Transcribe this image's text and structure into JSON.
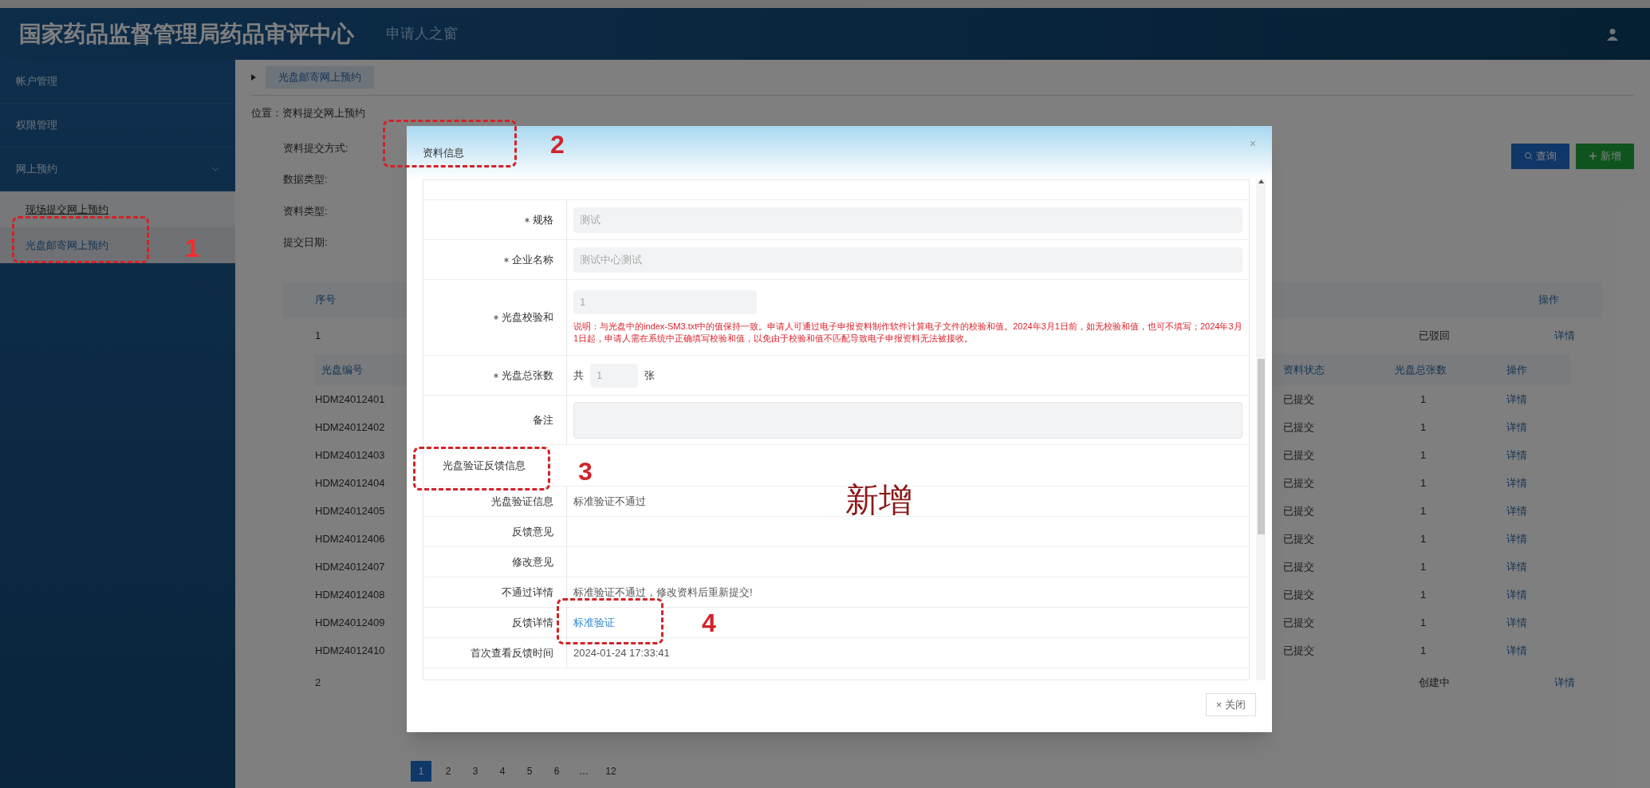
{
  "header": {
    "title": "国家药品监督管理局药品审评中心",
    "subtitle": "申请人之窗"
  },
  "sidebar": {
    "items": [
      {
        "label": "帐户管理",
        "selected": false
      },
      {
        "label": "权限管理",
        "selected": false
      },
      {
        "label": "网上预约",
        "selected": false,
        "expanded": true,
        "children": [
          {
            "label": "现场提交网上预约",
            "selected": false
          },
          {
            "label": "光盘邮寄网上预约",
            "selected": true
          }
        ]
      }
    ]
  },
  "tab_title": "光盘邮寄网上预约",
  "breadcrumb": "位置：资料提交网上预约",
  "filters": [
    "资料提交方式:",
    "数据类型:",
    "资料类型:",
    "提交日期:"
  ],
  "buttons": [
    {
      "label": "查询",
      "kind": "search"
    },
    {
      "label": "新增",
      "kind": "add"
    }
  ],
  "table": {
    "columns": [
      "序号",
      "操作"
    ],
    "rows": [
      {
        "index": "1",
        "status": "已驳回",
        "action": "详情",
        "sub_columns": [
          "光盘编号",
          "资料状态",
          "光盘总张数",
          "操作"
        ],
        "sub_rows": [
          {
            "code": "HDM24012401",
            "status": "已提交",
            "count": "1",
            "action": "详情"
          },
          {
            "code": "HDM24012402",
            "status": "已提交",
            "count": "1",
            "action": "详情"
          },
          {
            "code": "HDM24012403",
            "status": "已提交",
            "count": "1",
            "action": "详情"
          },
          {
            "code": "HDM24012404",
            "status": "已提交",
            "count": "1",
            "action": "详情"
          },
          {
            "code": "HDM24012405",
            "status": "已提交",
            "count": "1",
            "action": "详情"
          },
          {
            "code": "HDM24012406",
            "status": "已提交",
            "count": "1",
            "action": "详情"
          },
          {
            "code": "HDM24012407",
            "status": "已提交",
            "count": "1",
            "action": "详情"
          },
          {
            "code": "HDM24012408",
            "status": "已提交",
            "count": "1",
            "action": "详情"
          },
          {
            "code": "HDM24012409",
            "status": "已提交",
            "count": "1",
            "action": "详情"
          },
          {
            "code": "HDM24012410",
            "status": "已提交",
            "count": "1",
            "action": "详情"
          }
        ]
      },
      {
        "index": "2",
        "status": "创建中",
        "action": "详情"
      }
    ]
  },
  "pagination": [
    {
      "label": "1",
      "selected": true
    },
    {
      "label": "2",
      "selected": false
    },
    {
      "label": "3",
      "selected": false
    },
    {
      "label": "4",
      "selected": false
    },
    {
      "label": "5",
      "selected": false
    },
    {
      "label": "6",
      "selected": false
    },
    {
      "label": "…",
      "selected": false
    },
    {
      "label": "12",
      "selected": false
    }
  ],
  "modal": {
    "title": "资料信息",
    "close": "×",
    "fields": [
      {
        "kind": "input",
        "label": "规格",
        "required": true,
        "value": "测试"
      },
      {
        "kind": "input",
        "label": "企业名称",
        "required": true,
        "value": "测试中心测试"
      },
      {
        "kind": "checksum",
        "label": "光盘校验和",
        "required": true,
        "value": "1",
        "note": "说明：与光盘中的index-SM3.txt中的值保持一致。申请人可通过电子申报资料制作软件计算电子文件的校验和值。2024年3月1日前，如无校验和值，也可不填写；2024年3月1日起，申请人需在系统中正确填写校验和值，以免由于校验和值不匹配导致电子申报资料无法被接收。"
      },
      {
        "kind": "count",
        "label": "光盘总张数",
        "required": true,
        "prefix": "共",
        "value": "1",
        "suffix": "张"
      },
      {
        "kind": "textarea",
        "label": "备注",
        "required": false
      },
      {
        "kind": "section",
        "label": "光盘验证反馈信息"
      },
      {
        "kind": "text",
        "label": "光盘验证信息",
        "value": "标准验证不通过"
      },
      {
        "kind": "text",
        "label": "反馈意见"
      },
      {
        "kind": "text",
        "label": "修改意见"
      },
      {
        "kind": "text",
        "label": "不通过详情",
        "value": "标准验证不通过，修改资料后重新提交!"
      },
      {
        "kind": "link",
        "label": "反馈详情",
        "value": "标准验证"
      },
      {
        "kind": "text",
        "label": "首次查看反馈时间",
        "value": "2024-01-24 17:33:41"
      }
    ],
    "close_button": "× 关闭"
  },
  "annotations": [
    "1",
    "2",
    "3",
    "4"
  ],
  "annotation_note": "新增"
}
